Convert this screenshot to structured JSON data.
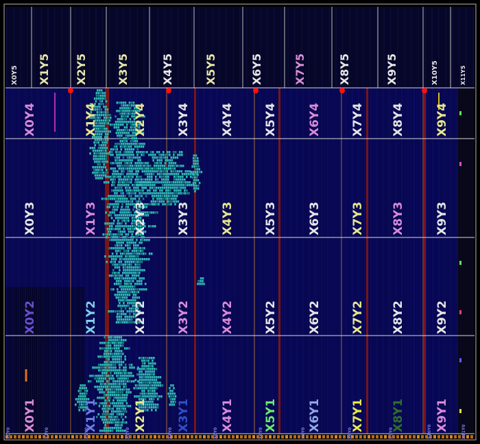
{
  "colors": {
    "background": "#000000",
    "fabric": "#07074f",
    "fabric_alt": "#0a0a66",
    "grid_line": "#d9d9d9",
    "logic_fill": "#2fb6b0",
    "logic_dark": "#1a7f80",
    "column_red": "#7a1515",
    "column_orange": "#e0902a",
    "marker_red": "#ff1010"
  },
  "top_row": {
    "labels": [
      {
        "text": "X0Y5",
        "color": "#dddddd"
      },
      {
        "text": "X1Y5",
        "color": "#e6e6a8"
      },
      {
        "text": "X2Y5",
        "color": "#e6e6a8"
      },
      {
        "text": "X3Y5",
        "color": "#e6e6a8"
      },
      {
        "text": "X4Y5",
        "color": "#e6e6e6"
      },
      {
        "text": "X5Y5",
        "color": "#e6e6a8"
      },
      {
        "text": "X6Y5",
        "color": "#e6e6e6"
      },
      {
        "text": "X7Y5",
        "color": "#d88ed8"
      },
      {
        "text": "X8Y5",
        "color": "#e6e6e6"
      },
      {
        "text": "X9Y5",
        "color": "#e6e6e6"
      },
      {
        "text": "X10Y5",
        "color": "#e6e6e6"
      },
      {
        "text": "X11Y5",
        "color": "#e6e6e6"
      }
    ]
  },
  "clock_regions": [
    {
      "row": 4,
      "labels": [
        {
          "text": "X0Y4",
          "color": "#d98bd9"
        },
        {
          "text": "X1Y4",
          "color": "#e8e88c"
        },
        {
          "text": "X2Y4",
          "color": "#e8e88c"
        },
        {
          "text": "X3Y4",
          "color": "#e6e6e6"
        },
        {
          "text": "X4Y4",
          "color": "#e6e6e6"
        },
        {
          "text": "X5Y4",
          "color": "#e6e6e6"
        },
        {
          "text": "X6Y4",
          "color": "#d98bd9"
        },
        {
          "text": "X7Y4",
          "color": "#e6e6e6"
        },
        {
          "text": "X8Y4",
          "color": "#e6e6e6"
        },
        {
          "text": "X9Y4",
          "color": "#e8e88c"
        }
      ]
    },
    {
      "row": 3,
      "labels": [
        {
          "text": "X0Y3",
          "color": "#e6e6e6"
        },
        {
          "text": "X1Y3",
          "color": "#d98bd9"
        },
        {
          "text": "X2Y3",
          "color": "#e6e6e6"
        },
        {
          "text": "X3Y3",
          "color": "#e6e6e6"
        },
        {
          "text": "X4Y3",
          "color": "#e8e88c"
        },
        {
          "text": "X5Y3",
          "color": "#e6e6e6"
        },
        {
          "text": "X6Y3",
          "color": "#e6e6e6"
        },
        {
          "text": "X7Y3",
          "color": "#e8e88c"
        },
        {
          "text": "X8Y3",
          "color": "#d98bd9"
        },
        {
          "text": "X9Y3",
          "color": "#e6e6e6"
        }
      ]
    },
    {
      "row": 2,
      "labels": [
        {
          "text": "X0Y2",
          "color": "#6a4fd0"
        },
        {
          "text": "X1Y2",
          "color": "#7fd2e6"
        },
        {
          "text": "X2Y2",
          "color": "#e6e6e6"
        },
        {
          "text": "X3Y2",
          "color": "#d98bd9"
        },
        {
          "text": "X4Y2",
          "color": "#d98bd9"
        },
        {
          "text": "X5Y2",
          "color": "#e6e6e6"
        },
        {
          "text": "X6Y2",
          "color": "#e6e6e6"
        },
        {
          "text": "X7Y2",
          "color": "#e8e88c"
        },
        {
          "text": "X8Y2",
          "color": "#e6e6e6"
        },
        {
          "text": "X9Y2",
          "color": "#e6e6e6"
        }
      ]
    },
    {
      "row": 1,
      "labels": [
        {
          "text": "X0Y1",
          "color": "#d98bd9"
        },
        {
          "text": "X1Y1",
          "color": "#6a7fe6"
        },
        {
          "text": "X2Y1",
          "color": "#e8e88c"
        },
        {
          "text": "X3Y1",
          "color": "#2f4fc8"
        },
        {
          "text": "X4Y1",
          "color": "#d98bd9"
        },
        {
          "text": "X5Y1",
          "color": "#6de86d"
        },
        {
          "text": "X6Y1",
          "color": "#8fa6e6"
        },
        {
          "text": "X7Y1",
          "color": "#e8e84a"
        },
        {
          "text": "X8Y1",
          "color": "#2f6f2f"
        },
        {
          "text": "X9Y1",
          "color": "#d98bd9"
        }
      ]
    }
  ],
  "bottom_row": {
    "labels": [
      "X0Y0",
      "X1Y0",
      "X2Y0",
      "X3Y0",
      "X4Y0",
      "X5Y0",
      "X6Y0",
      "X7Y0",
      "X8Y0",
      "X9Y0",
      "X10Y0",
      "X11Y0"
    ]
  }
}
